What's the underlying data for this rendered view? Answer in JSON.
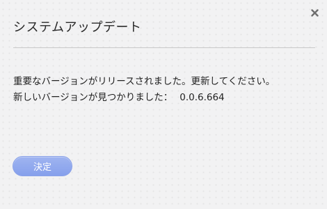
{
  "dialog": {
    "title": "システムアップデート",
    "close_icon": "close-icon",
    "message_line1": "重要なバージョンがリリースされました。更新してください。",
    "message_line2_label": "新しいバージョンが見つかりました：",
    "new_version": "0.0.6.664",
    "confirm_label": "決定"
  },
  "colors": {
    "background": "#f2f2f3",
    "button": "#93aaee",
    "divider": "#c9c9c9"
  }
}
